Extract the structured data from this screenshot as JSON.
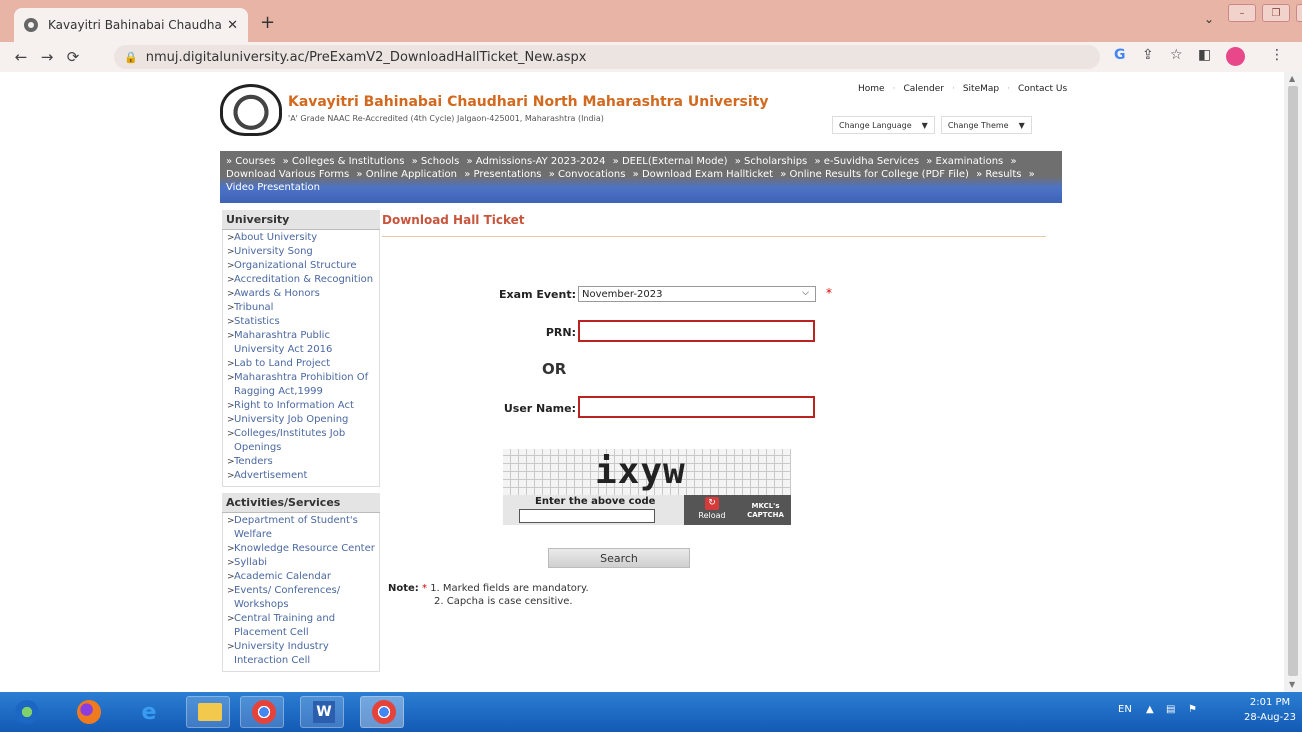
{
  "browser": {
    "tab_title": "Kavayitri Bahinabai Chaudhari No",
    "tab_close": "✕",
    "new_tab": "+",
    "url": "nmuj.digitaluniversity.ac/PreExamV2_DownloadHallTicket_New.aspx",
    "nav_icons": [
      "back-icon",
      "forward-icon",
      "reload-icon"
    ]
  },
  "header": {
    "university_name": "Kavayitri Bahinabai Chaudhari North Maharashtra University",
    "subtitle": "'A' Grade NAAC Re-Accredited (4th Cycle) Jalgaon-425001, Maharashtra (India)",
    "top_links": [
      "Home",
      "Calender",
      "SiteMap",
      "Contact Us"
    ],
    "change_language": "Change Language",
    "change_theme": "Change Theme"
  },
  "nav": {
    "items": [
      "» Courses",
      "» Colleges & Institutions",
      "» Schools",
      "» Admissions-AY 2023-2024",
      "» DEEL(External Mode)",
      "» Scholarships",
      "» e-Suvidha Services",
      "» Examinations",
      "» Download Various Forms",
      "» Online Application",
      "» Presentations",
      "» Convocations",
      "» Download Exam Hallticket",
      "» Online Results for College (PDF File)",
      "» Results",
      "» Video Presentation"
    ]
  },
  "sidebar": {
    "university_heading": "University",
    "university_items": [
      "About University",
      "University Song",
      "Organizational Structure",
      "Accreditation & Recognition",
      "Awards & Honors",
      "Tribunal",
      "Statistics",
      "Maharashtra Public University Act 2016",
      "Lab to Land Project",
      "Maharashtra Prohibition Of Ragging Act,1999",
      "Right to Information Act",
      "University Job Opening",
      "Colleges/Institutes Job Openings",
      "Tenders",
      "Advertisement"
    ],
    "activities_heading": "Activities/Services",
    "activities_items": [
      "Department of Student's Welfare",
      "Knowledge Resource Center",
      "Syllabi",
      "Academic Calendar",
      "Events/ Conferences/ Workshops",
      "Central Training and Placement Cell",
      "University Industry Interaction Cell"
    ]
  },
  "main": {
    "title": "Download Hall Ticket",
    "exam_event_label": "Exam Event:",
    "exam_event_value": "November-2023",
    "prn_label": "PRN:",
    "or_text": "OR",
    "username_label": "User Name:",
    "captcha_text": "ixyw",
    "captcha_prompt": "Enter the above code",
    "reload_label": "Reload",
    "captcha_brand": "MKCL's CAPTCHA",
    "search_label": "Search",
    "note_label": "Note:",
    "note_1": "1. Marked fields are mandatory.",
    "note_2": "2. Capcha is case censitive."
  },
  "taskbar": {
    "lang": "EN",
    "time": "2:01 PM",
    "date": "28-Aug-23"
  }
}
